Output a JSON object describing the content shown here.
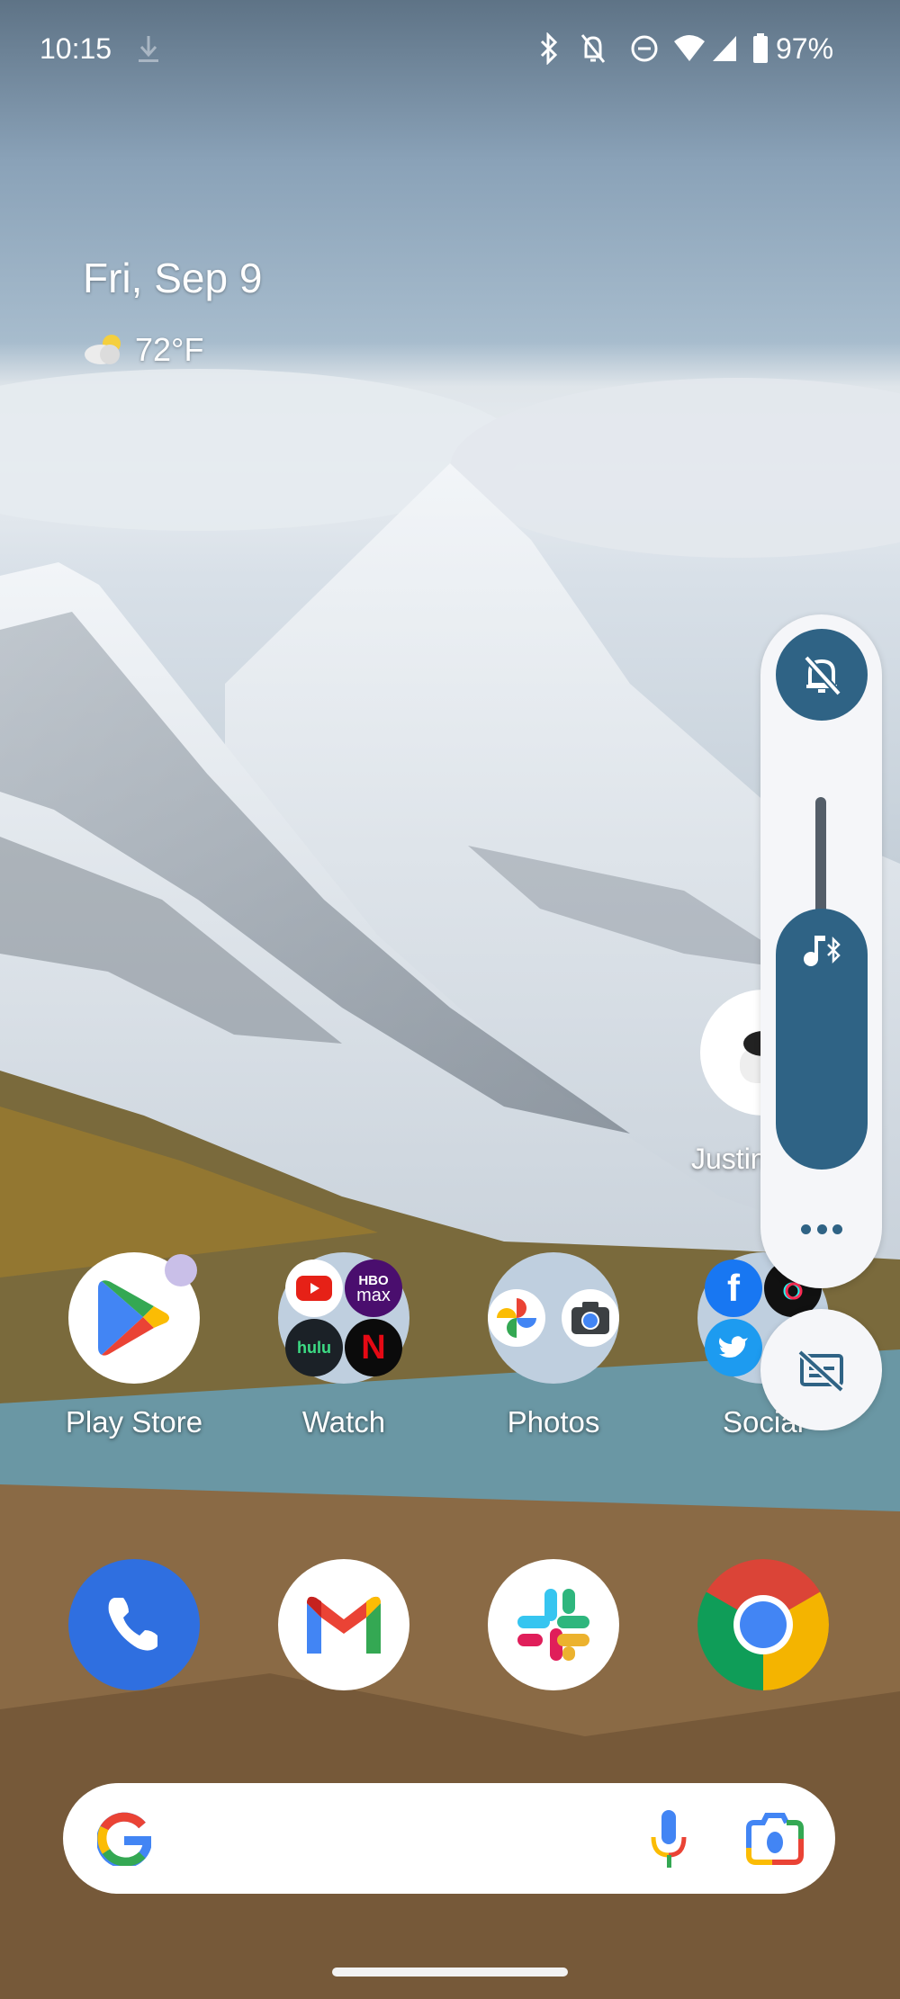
{
  "status_bar": {
    "time": "10:15",
    "left_icons": [
      "download-icon"
    ],
    "right_icons": [
      "bluetooth-icon",
      "notifications-off-icon",
      "do-not-disturb-icon",
      "wifi-icon",
      "cell-signal-icon",
      "battery-icon"
    ],
    "battery_percent": "97%"
  },
  "glance_widget": {
    "date": "Fri, Sep 9",
    "weather_icon": "partly-cloudy-icon",
    "temperature": "72°F"
  },
  "volume_panel": {
    "ringer_mode": "muted",
    "ringer_icon": "bell-off-icon",
    "media_stream_icon": "music-bluetooth-icon",
    "media_volume_fraction": 0.7,
    "more_settings_icon": "more-horiz-icon",
    "live_caption_icon": "captions-off-icon",
    "colors": {
      "accent": "#2f6385",
      "panel": "#f5f6f9",
      "track": "#545e69"
    }
  },
  "partially_hidden_widget": {
    "label": "Justin",
    "icon": "earbuds-icon"
  },
  "home_row": [
    {
      "label": "Play Store",
      "type": "app",
      "icon": "play-store-icon",
      "has_notification_dot": true
    },
    {
      "label": "Watch",
      "type": "folder",
      "apps": [
        "YouTube",
        "HBO Max",
        "Hulu",
        "Netflix"
      ]
    },
    {
      "label": "Photos",
      "type": "folder",
      "apps": [
        "Google Photos",
        "Camera"
      ]
    },
    {
      "label": "Social",
      "type": "folder",
      "apps": [
        "Facebook",
        "TikTok",
        "Twitter"
      ]
    }
  ],
  "mini_text": {
    "hbo": "HBO",
    "max": "max",
    "hulu": "hulu",
    "netflix": "N",
    "facebook": "f"
  },
  "dock": [
    {
      "name": "Phone",
      "icon": "phone-icon"
    },
    {
      "name": "Gmail",
      "icon": "gmail-icon"
    },
    {
      "name": "Slack",
      "icon": "slack-icon"
    },
    {
      "name": "Chrome",
      "icon": "chrome-icon"
    }
  ],
  "search_bar": {
    "logo": "google-g-icon",
    "voice_icon": "mic-icon",
    "lens_icon": "lens-icon"
  }
}
